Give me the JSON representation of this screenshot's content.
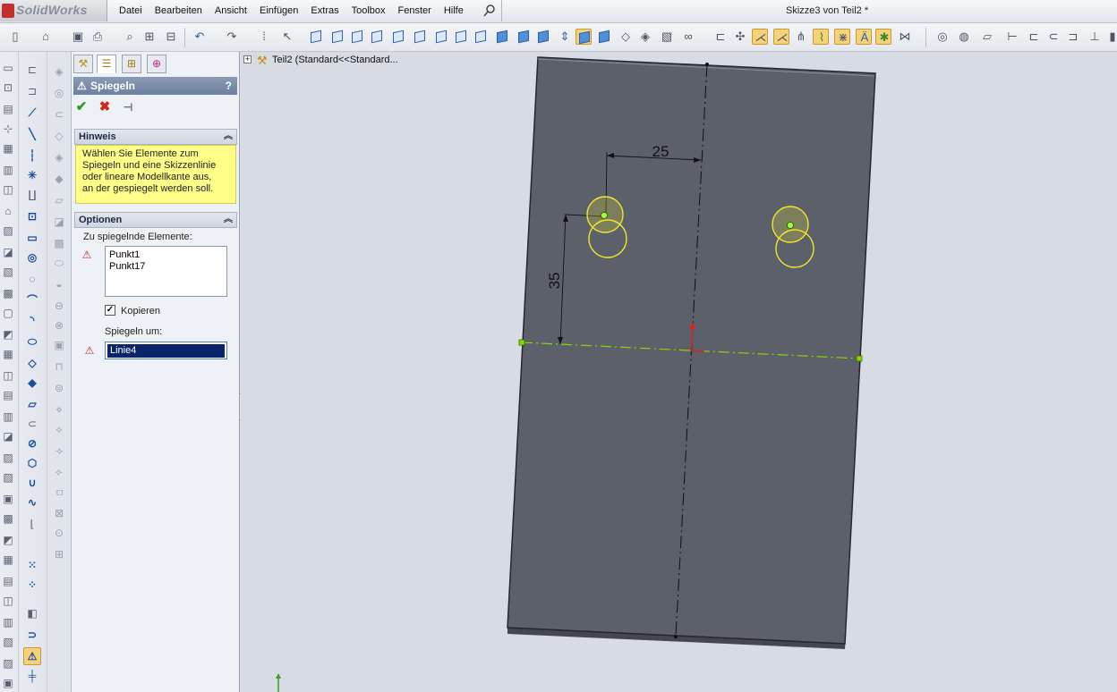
{
  "app": {
    "logo_text": "SolidWorks",
    "document_title": "Skizze3 von Teil2 *"
  },
  "menu": [
    "Datei",
    "Bearbeiten",
    "Ansicht",
    "Einfügen",
    "Extras",
    "Toolbox",
    "Fenster",
    "Hilfe"
  ],
  "property_manager": {
    "title": "Spiegeln",
    "help": "?",
    "hint_group": {
      "title": "Hinweis",
      "lines": [
        "Wählen Sie Elemente zum",
        "Spiegeln und eine Skizzenlinie",
        "oder lineare Modellkante aus,",
        "an der gespiegelt werden soll."
      ]
    },
    "options_group": {
      "title": "Optionen",
      "entities_label": "Zu spiegelnde Elemente:",
      "entities": [
        "Punkt1",
        "Punkt17"
      ],
      "copy_label": "Kopieren",
      "copy_checked": true,
      "mirror_about_label": "Spiegeln um:",
      "mirror_about_value": "Linie4"
    }
  },
  "feature_tree": {
    "root_label": "Teil2  (Standard<<Standard..."
  },
  "sketch": {
    "dimension_horizontal": "25",
    "dimension_vertical": "35",
    "colors": {
      "plate": "#5c606b",
      "plate_edge": "#25272d",
      "centerline": "#111111",
      "mirror_line": "#8bd400",
      "circles": "#f0e62a",
      "point": "#9cff3a"
    }
  }
}
